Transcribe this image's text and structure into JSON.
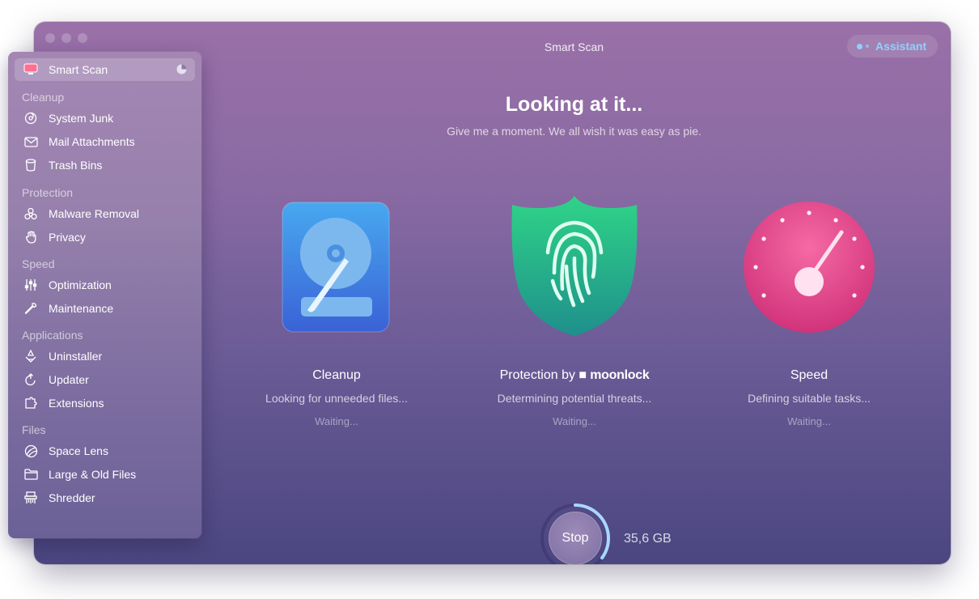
{
  "window": {
    "title": "Smart Scan",
    "assistant_label": "Assistant"
  },
  "main": {
    "heading": "Looking at it...",
    "subheading": "Give me a moment. We all wish it was easy as pie.",
    "modules": [
      {
        "title": "Cleanup",
        "status": "Looking for unneeded files...",
        "state": "Waiting..."
      },
      {
        "title_prefix": "Protection by",
        "brand": "moonlock",
        "status": "Determining potential threats...",
        "state": "Waiting..."
      },
      {
        "title": "Speed",
        "status": "Defining suitable tasks...",
        "state": "Waiting..."
      }
    ],
    "stop_label": "Stop",
    "scanned_size": "35,6 GB",
    "scan_progress": 0.35
  },
  "sidebar": {
    "active": {
      "label": "Smart Scan",
      "icon": "monitor-icon"
    },
    "sections": [
      {
        "title": "Cleanup",
        "items": [
          {
            "label": "System Junk",
            "icon": "system-junk-icon"
          },
          {
            "label": "Mail Attachments",
            "icon": "envelope-icon"
          },
          {
            "label": "Trash Bins",
            "icon": "trash-icon"
          }
        ]
      },
      {
        "title": "Protection",
        "items": [
          {
            "label": "Malware Removal",
            "icon": "biohazard-icon"
          },
          {
            "label": "Privacy",
            "icon": "hand-icon"
          }
        ]
      },
      {
        "title": "Speed",
        "items": [
          {
            "label": "Optimization",
            "icon": "sliders-icon"
          },
          {
            "label": "Maintenance",
            "icon": "wrench-icon"
          }
        ]
      },
      {
        "title": "Applications",
        "items": [
          {
            "label": "Uninstaller",
            "icon": "uninstaller-icon"
          },
          {
            "label": "Updater",
            "icon": "updater-icon"
          },
          {
            "label": "Extensions",
            "icon": "extensions-icon"
          }
        ]
      },
      {
        "title": "Files",
        "items": [
          {
            "label": "Space Lens",
            "icon": "space-lens-icon"
          },
          {
            "label": "Large & Old Files",
            "icon": "folder-icon"
          },
          {
            "label": "Shredder",
            "icon": "shredder-icon"
          }
        ]
      }
    ]
  },
  "colors": {
    "accent": "#8fd0ff",
    "cleanup": "#3a8ee6",
    "protection": "#25c58f",
    "speed": "#e9458c"
  }
}
